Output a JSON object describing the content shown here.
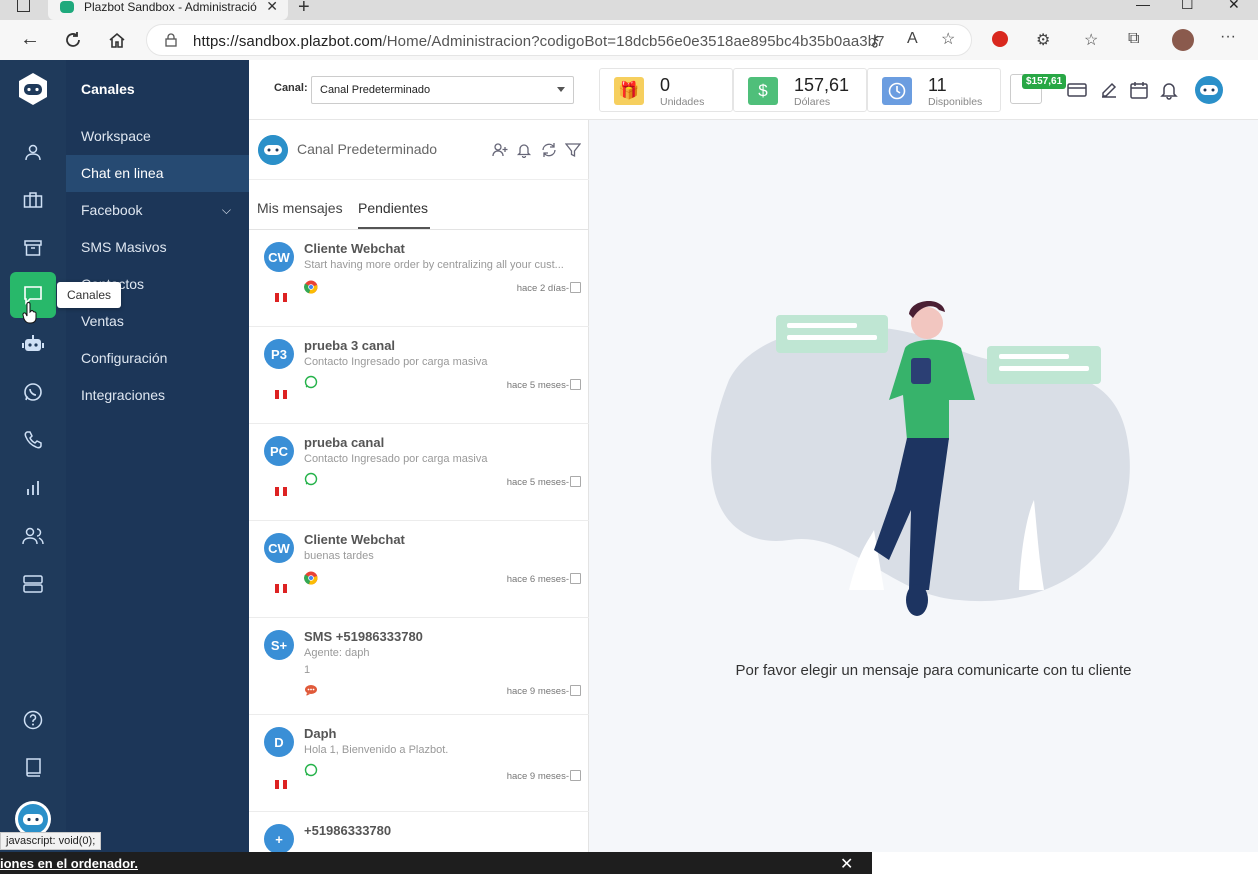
{
  "browser": {
    "tab_title": "Plazbot Sandbox - Administració",
    "tab_close": "✕",
    "new_tab": "+",
    "url_host": "https://sandbox.plazbot.com",
    "url_path": "/Home/Administracion?codigoBot=18dcb56e0e3518ae895bc4b35b0aa3b7",
    "win_min": "—",
    "win_max": "☐",
    "win_close": "✕",
    "more": "···"
  },
  "rail": {
    "tooltip": "Canales"
  },
  "menu": {
    "title": "Canales",
    "items": [
      {
        "label": "Workspace"
      },
      {
        "label": "Chat en linea"
      },
      {
        "label": "Facebook"
      },
      {
        "label": "SMS Masivos"
      },
      {
        "label": "Contactos"
      },
      {
        "label": "Ventas"
      },
      {
        "label": "Configuración"
      },
      {
        "label": "Integraciones"
      }
    ]
  },
  "topbar": {
    "canal_label": "Canal:",
    "canal_selected": "Canal Predeterminado",
    "stats": [
      {
        "value": "0",
        "label": "Unidades",
        "color": "#f6cf5e"
      },
      {
        "value": "157,61",
        "label": "Dólares",
        "color": "#4fbf7a"
      },
      {
        "value": "11",
        "label": "Disponibles",
        "color": "#6b9de0"
      }
    ],
    "money_badge": "$157,61"
  },
  "chatpanel": {
    "channel_name": "Canal Predeterminado",
    "tabs": [
      "Mis mensajes",
      "Pendientes"
    ],
    "chats": [
      {
        "initials": "CW",
        "name": "Cliente Webchat",
        "message": "Start having more order by centralizing all your cust...",
        "message2": "",
        "channel": "chrome",
        "time": "hace 2 días-",
        "flag": true
      },
      {
        "initials": "P3",
        "name": "prueba 3 canal",
        "message": "Contacto Ingresado por carga masiva",
        "message2": "",
        "channel": "whatsapp",
        "time": "hace 5 meses-",
        "flag": true
      },
      {
        "initials": "PC",
        "name": "prueba canal",
        "message": "Contacto Ingresado por carga masiva",
        "message2": "",
        "channel": "whatsapp",
        "time": "hace 5 meses-",
        "flag": true
      },
      {
        "initials": "CW",
        "name": "Cliente Webchat",
        "message": "buenas tardes",
        "message2": "",
        "channel": "chrome",
        "time": "hace 6 meses-",
        "flag": true
      },
      {
        "initials": "S+",
        "name": "SMS +51986333780",
        "message": "Agente: daph",
        "message2": "1",
        "channel": "sms",
        "time": "hace 9 meses-",
        "flag": false
      },
      {
        "initials": "D",
        "name": "Daph",
        "message": "Hola 1, Bienvenido a Plazbot.",
        "message2": "",
        "channel": "whatsapp",
        "time": "hace 9 meses-",
        "flag": true
      },
      {
        "initials": "+",
        "name": "+51986333780",
        "message": "",
        "message2": "",
        "channel": "",
        "time": "",
        "flag": false
      }
    ]
  },
  "content": {
    "empty_message": "Por favor elegir un mensaje para comunicarte con tu cliente"
  },
  "statusbar": "javascript: void(0);",
  "downloadbar": {
    "text": "iones en el ordenador.",
    "close": "✕"
  }
}
